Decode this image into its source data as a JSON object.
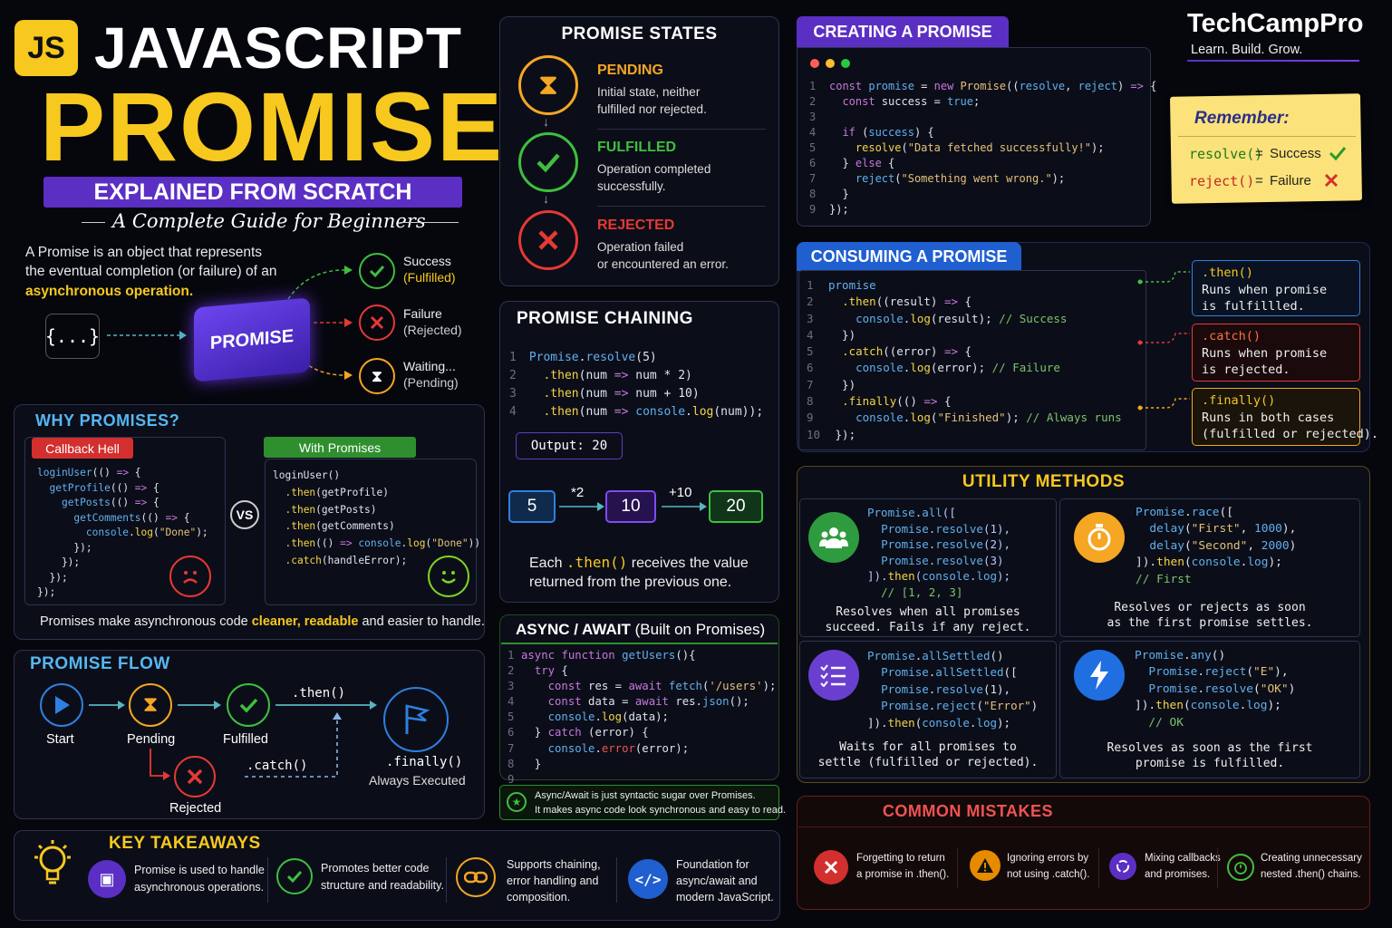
{
  "header": {
    "js_badge": "JS",
    "title_line1": "JAVASCRIPT",
    "title_line2": "PROMISES",
    "ribbon": "EXPLAINED FROM SCRATCH",
    "subtitle": "A Complete Guide for Beginners"
  },
  "brand": {
    "name": "TechCampPro",
    "tagline": "Learn. Build. Grow."
  },
  "intro": {
    "text_a": "A Promise is an object that represents",
    "text_b": "the eventual completion (or failure) of an",
    "highlight": "asynchronous operation.",
    "braces": "{...}",
    "box_label": "PROMISE",
    "outcomes": [
      {
        "label": "Success",
        "state": "(Fulfilled)"
      },
      {
        "label": "Failure",
        "state": "(Rejected)"
      },
      {
        "label": "Waiting...",
        "state": "(Pending)"
      }
    ]
  },
  "states": {
    "title": "PROMISE STATES",
    "items": [
      {
        "name": "PENDING",
        "desc1": "Initial state, neither",
        "desc2": "fulfilled nor rejected."
      },
      {
        "name": "FULFILLED",
        "desc1": "Operation completed",
        "desc2": "successfully."
      },
      {
        "name": "REJECTED",
        "desc1": "Operation failed",
        "desc2": "or encountered an error."
      }
    ]
  },
  "creating": {
    "title": "CREATING A PROMISE"
  },
  "remember": {
    "title": "Remember:",
    "resolve": "resolve()",
    "eq": "=",
    "success": "Success",
    "reject": "reject()",
    "failure": "Failure"
  },
  "why": {
    "title": "WHY PROMISES?",
    "hell_label": "Callback Hell",
    "with_label": "With Promises",
    "vs": "VS",
    "footer_a": "Promises make asynchronous code ",
    "footer_b": "cleaner, readable",
    "footer_c": " and easier to handle."
  },
  "chaining": {
    "title": "PROMISE CHAINING",
    "output": "Output: 20",
    "values": [
      "5",
      "10",
      "20"
    ],
    "ops": [
      "*2",
      "+10"
    ],
    "note_a": "Each ",
    "note_code": ".then()",
    "note_b": " receives the value",
    "note_c": "returned from the previous one."
  },
  "consuming": {
    "title": "CONSUMING A PROMISE",
    "callouts": [
      {
        "name": ".then()",
        "d1": "Runs when promise",
        "d2": "is fulfillled."
      },
      {
        "name": ".catch()",
        "d1": "Runs when promise",
        "d2": "is rejected."
      },
      {
        "name": ".finally()",
        "d1": "Runs in both cases",
        "d2": "(fulfilled or rejected)."
      }
    ]
  },
  "utility": {
    "title": "UTILITY METHODS",
    "all_desc1": "Resolves when all promises",
    "all_desc2": "succeed. Fails if any reject.",
    "race_desc1": "Resolves or rejects as soon",
    "race_desc2": "as the first promise settles.",
    "settled_desc1": "Waits for all promises to",
    "settled_desc2": "settle (fulfilled or rejected).",
    "any_desc1": "Resolves as soon as the first",
    "any_desc2": "promise is fulfilled."
  },
  "flow": {
    "title": "PROMISE FLOW",
    "start": "Start",
    "pending": "Pending",
    "fulfilled": "Fulfilled",
    "rejected": "Rejected",
    "then": ".then()",
    "catch": ".catch()",
    "finally": ".finally()",
    "always": "Always Executed"
  },
  "async": {
    "title": "ASYNC / AWAIT",
    "title_suffix": "(Built on Promises)",
    "note1": "Async/Await is just syntactic sugar over Promises.",
    "note2": "It makes async code look synchronous and easy to read."
  },
  "takeaways": {
    "title": "KEY TAKEAWAYS",
    "items": [
      {
        "l1": "Promise is used to handle",
        "l2": "asynchronous operations."
      },
      {
        "l1": "Promotes better code",
        "l2": "structure and readability."
      },
      {
        "l1": "Supports chaining,",
        "l2": "error handling and",
        "l3": "composition."
      },
      {
        "l1": "Foundation for",
        "l2": "async/await and",
        "l3": "modern JavaScript."
      }
    ]
  },
  "mistakes": {
    "title": "COMMON MISTAKES",
    "items": [
      {
        "l1": "Forgetting to return",
        "l2": "a promise in .then()."
      },
      {
        "l1": "Ignoring errors by",
        "l2": "not using .catch()."
      },
      {
        "l1": "Mixing callbacks",
        "l2": "and promises."
      },
      {
        "l1": "Creating unnecessary",
        "l2": "nested .then() chains."
      }
    ]
  },
  "colors": {
    "yellow": "#f7c81e",
    "purple": "#5b2fc4",
    "green": "#3fbf3f",
    "red": "#e53935",
    "blue": "#2f7fe0",
    "orange": "#f5a623"
  }
}
